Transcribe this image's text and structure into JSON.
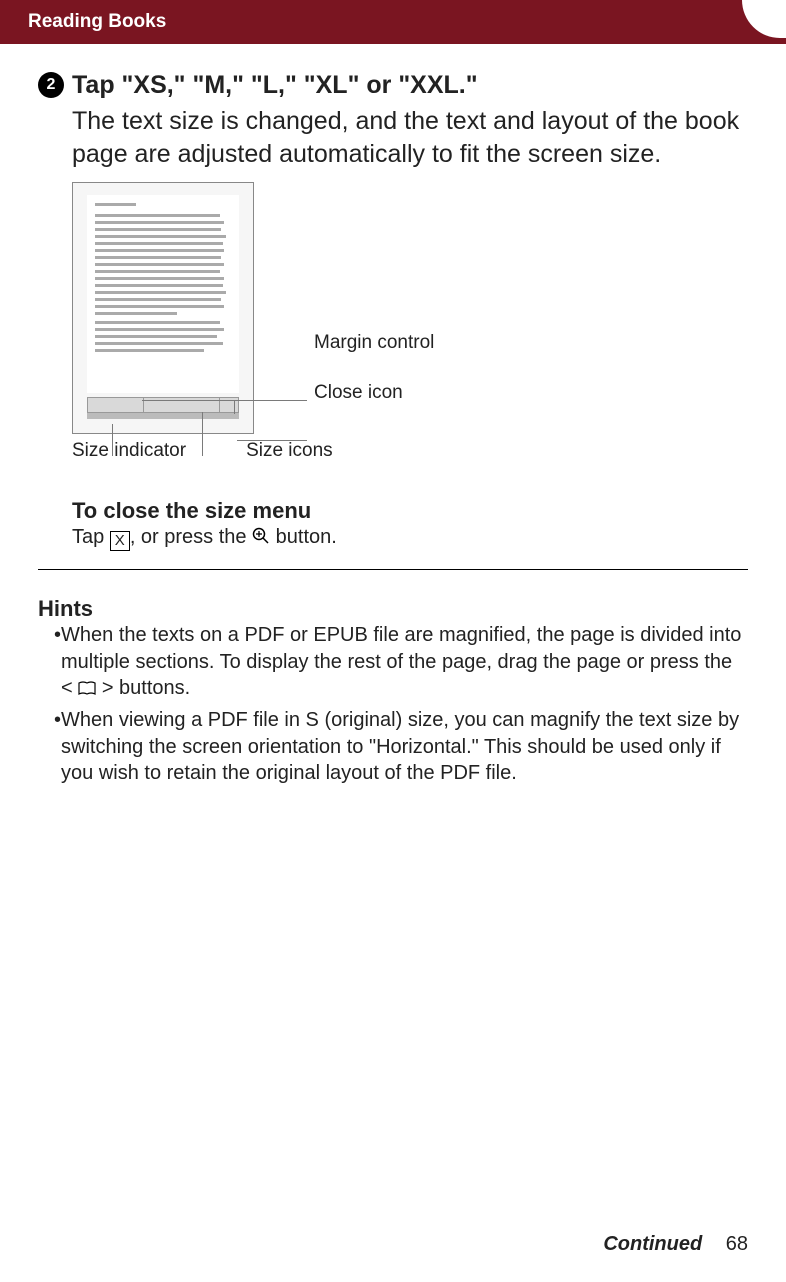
{
  "header": {
    "section": "Reading Books"
  },
  "step": {
    "number": "2",
    "heading": "Tap \"XS,\" \"M,\" \"L,\" \"XL\" or \"XXL.\"",
    "body": "The text size is changed, and the text and layout of the book page are adjusted automatically to fit the screen size."
  },
  "diagram": {
    "labels": {
      "margin_control": "Margin control",
      "close_icon": "Close icon",
      "size_icons": "Size icons",
      "size_indicator": "Size indicator"
    }
  },
  "close_menu": {
    "heading": "To close the size menu",
    "tap_word": "Tap ",
    "x_char": "X",
    "press_text": ", or press the ",
    "button_suffix": " button."
  },
  "hints": {
    "heading": "Hints",
    "items": [
      {
        "pre": "When the texts on a PDF or EPUB file are magnified, the page is divided into multiple sections. To display the rest of the page, drag the page or press the < ",
        "post": " > buttons."
      },
      {
        "text": "When viewing a PDF file in S (original) size, you can magnify the text size by switching the screen orientation to \"Horizontal.\" This should be used only if you wish to retain the original layout of the PDF file."
      }
    ]
  },
  "footer": {
    "continued": "Continued",
    "page": "68"
  }
}
